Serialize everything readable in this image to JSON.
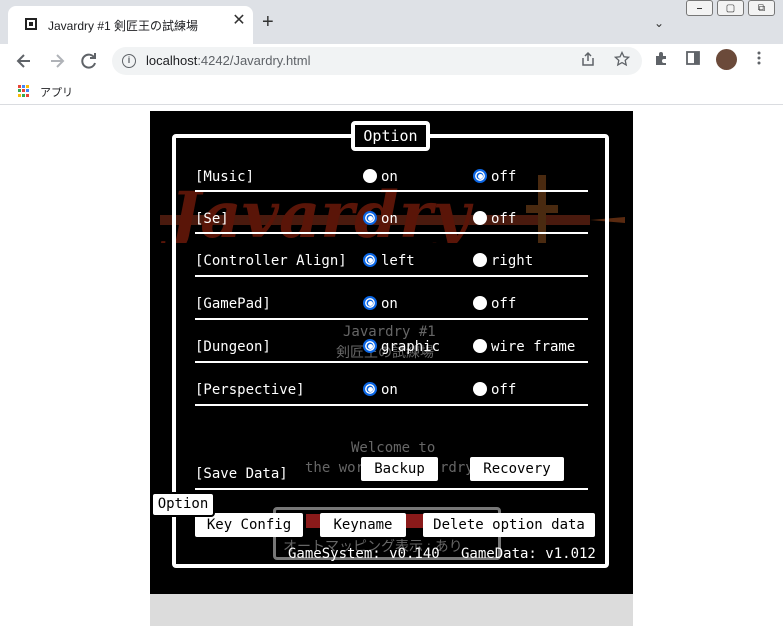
{
  "browser": {
    "tab_title": "Javardry #1 剣匠王の試練場",
    "tab_close": "✕",
    "new_tab": "+",
    "tab_search": "⌄",
    "window_buttons": [
      "⎯",
      "▢",
      "⧉"
    ],
    "url_host": "localhost",
    "url_rest": ":4242/Javardry.html",
    "bookmark_apps_label": "アプリ",
    "icons": [
      "back-arrow-icon",
      "forward-arrow-icon",
      "reload-icon",
      "info-icon",
      "share-icon",
      "star-icon",
      "extensions-icon",
      "sidepanel-icon",
      "menu-icon"
    ]
  },
  "game": {
    "logo_text": "Javardry",
    "bg_title": "Javardry #1",
    "bg_subtitle": "剣匠王の試練場",
    "bg_welcome": "Welcome to",
    "bg_world": "the wor",
    "bg_world_tail": "rdry",
    "bg_automap": "オートマッピング表示 : あり",
    "option_title": "Option",
    "rows": [
      {
        "label": "[Music]",
        "opt1": "on",
        "opt2": "off",
        "selected": 2
      },
      {
        "label": "[Se]",
        "opt1": "on",
        "opt2": "off",
        "selected": 1
      },
      {
        "label": "[Controller Align]",
        "opt1": "left",
        "opt2": "right",
        "selected": 1
      },
      {
        "label": "[GamePad]",
        "opt1": "on",
        "opt2": "off",
        "selected": 1
      },
      {
        "label": "[Dungeon]",
        "opt1": "graphic",
        "opt2": "wire frame",
        "selected": 1
      },
      {
        "label": "[Perspective]",
        "opt1": "on",
        "opt2": "off",
        "selected": 1
      }
    ],
    "save_label": "[Save Data]",
    "backup_button": "Backup",
    "recovery_button": "Recovery",
    "key_config_button": "Key Config",
    "keyname_button": "Keyname",
    "delete_option_button": "Delete option data",
    "game_system": "GameSystem: v0.140",
    "game_data": "GameData: v1.012",
    "bottom_option_button": "Option"
  },
  "colors": {
    "accent_radio": "#0b66e4",
    "logo_red": "#6a1a0e",
    "game_bg": "#000000"
  }
}
